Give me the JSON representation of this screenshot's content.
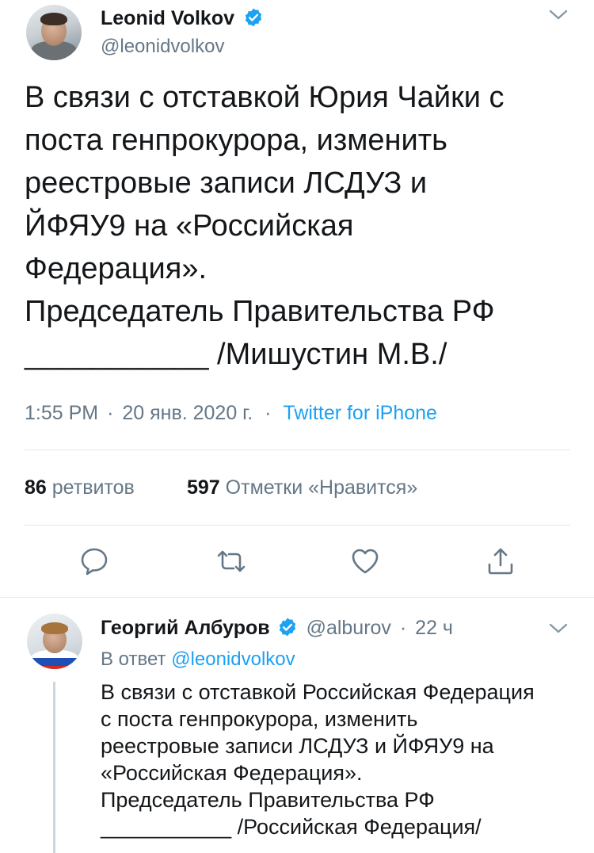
{
  "tweet": {
    "author_name": "Leonid Volkov",
    "author_handle": "@leonidvolkov",
    "text": "В связи с отставкой Юрия Чайки с\nпоста генпрокурора, изменить\nреестровые записи ЛСДУЗ и\nЙФЯУ9 на «Российская\nФедерация».\nПредседатель Правительства РФ\n___________ /Мишустин М.В./",
    "time": "1:55 PM",
    "date": "20 янв. 2020 г.",
    "separator": "·",
    "source": "Twitter for iPhone",
    "retweets_count": "86",
    "retweets_label": "ретвитов",
    "likes_count": "597",
    "likes_label": "Отметки «Нравится»"
  },
  "reply": {
    "author_name": "Георгий Албуров",
    "author_handle": "@alburov",
    "separator": "·",
    "time_ago": "22 ч",
    "in_reply_prefix": "В ответ",
    "in_reply_handle": "@leonidvolkov",
    "text": "В связи с отставкой Российская Федерация\nс поста генпрокурора, изменить\nреестровые записи ЛСДУЗ и ЙФЯУ9 на\n«Российская Федерация».\nПредседатель Правительства РФ\n___________ /Российская Федерация/"
  },
  "icons": {
    "verified": "verified-badge-icon",
    "more": "chevron-down-icon",
    "reply": "reply-icon",
    "retweet": "retweet-icon",
    "like": "heart-icon",
    "share": "share-icon"
  },
  "colors": {
    "accent": "#1da1f2",
    "text": "#14171a",
    "secondary": "#657786",
    "divider": "#e1e8ed"
  }
}
